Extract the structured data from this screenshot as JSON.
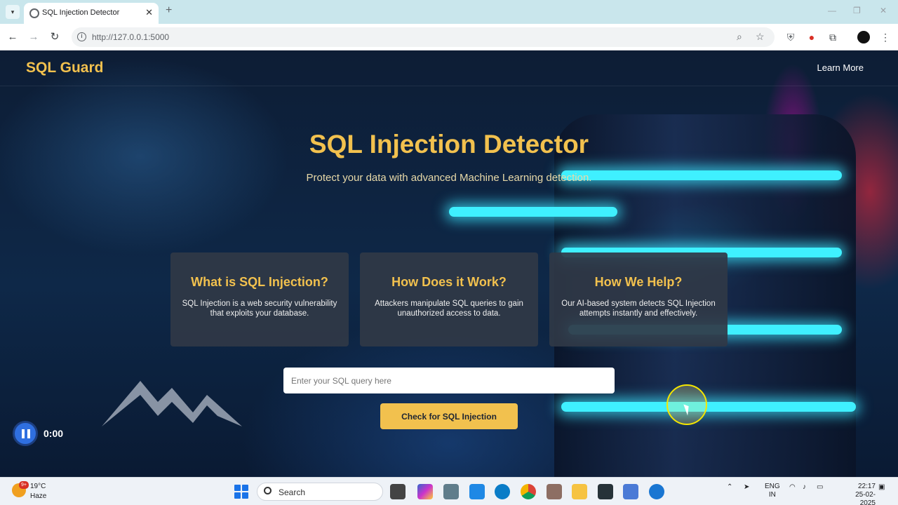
{
  "browser": {
    "tab_title": "SQL Injection Detector",
    "url": "http://127.0.0.1:5000"
  },
  "header": {
    "brand": "SQL Guard",
    "nav_link": "Learn More"
  },
  "hero": {
    "title": "SQL Injection Detector",
    "subtitle": "Protect your data with advanced Machine Learning detection."
  },
  "cards": [
    {
      "title": "What is SQL Injection?",
      "text": "SQL Injection is a web security vulnerability that exploits your database."
    },
    {
      "title": "How Does it Work?",
      "text": "Attackers manipulate SQL queries to gain unauthorized access to data."
    },
    {
      "title": "How We Help?",
      "text": "Our AI-based system detects SQL Injection attempts instantly and effectively."
    }
  ],
  "form": {
    "placeholder": "Enter your SQL query here",
    "value": "",
    "button_label": "Check for SQL Injection"
  },
  "player": {
    "time": "0:00"
  },
  "taskbar": {
    "weather_badge": "9+",
    "temperature": "19°C",
    "weather": "Haze",
    "search_label": "Search",
    "lang_line1": "ENG",
    "lang_line2": "IN",
    "time": "22:17",
    "date": "25-02-2025"
  },
  "colors": {
    "accent": "#f2c14e",
    "card_bg": "#303846",
    "page_bg": "#0e2848"
  }
}
